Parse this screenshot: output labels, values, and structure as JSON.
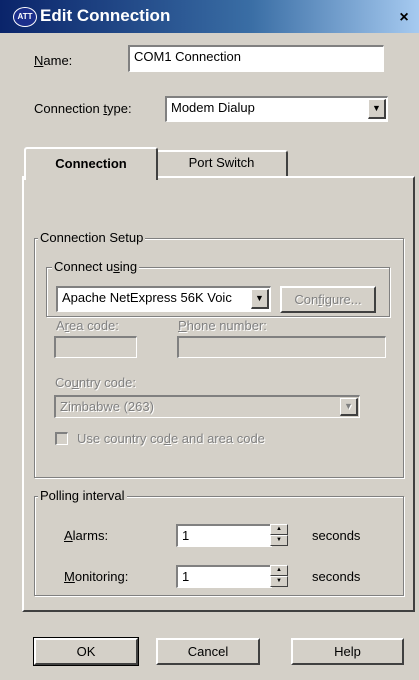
{
  "window": {
    "title": "Edit Connection",
    "icon_text": "ATT",
    "close_glyph": "×"
  },
  "name": {
    "label": "Name:",
    "label_key": "N",
    "label_rest": "ame:",
    "value": "COM1 Connection"
  },
  "connection_type": {
    "label_pre": "Connection ",
    "label_key": "t",
    "label_post": "ype:",
    "value": "Modem Dialup"
  },
  "tabs": [
    {
      "label": "Connection",
      "selected": true
    },
    {
      "label": "Port Switch",
      "selected": false
    }
  ],
  "connection_setup": {
    "group_label": "Connection Setup",
    "connect_using": {
      "group_label_pre": "Connect u",
      "group_label_key": "s",
      "group_label_post": "ing",
      "device": "Apache NetExpress 56K Voic",
      "configure_pre": "Con",
      "configure_key": "f",
      "configure_post": "igure..."
    },
    "area_code": {
      "label_pre": "A",
      "label_key": "r",
      "label_post": "ea code:",
      "value": ""
    },
    "phone_number": {
      "label_pre": "",
      "label_key": "P",
      "label_post": "hone number:",
      "value": ""
    },
    "country_code": {
      "label_pre": "Co",
      "label_key": "u",
      "label_post": "ntry code:",
      "value": "Zimbabwe (263)"
    },
    "use_country_code": {
      "label_pre": "Use country co",
      "label_key": "d",
      "label_post": "e and area code",
      "checked": false
    }
  },
  "polling": {
    "group_label": "Polling interval",
    "alarms": {
      "label_key": "A",
      "label_rest": "larms:",
      "value": "1",
      "unit": "seconds"
    },
    "monitoring": {
      "label_key": "M",
      "label_rest": "onitoring:",
      "value": "1",
      "unit": "seconds"
    }
  },
  "buttons": {
    "ok": "OK",
    "cancel": "Cancel",
    "help": "Help"
  },
  "colors": {
    "titlebar": "#0a246a",
    "face": "#d4d0c8",
    "disabled_text": "#808080"
  }
}
